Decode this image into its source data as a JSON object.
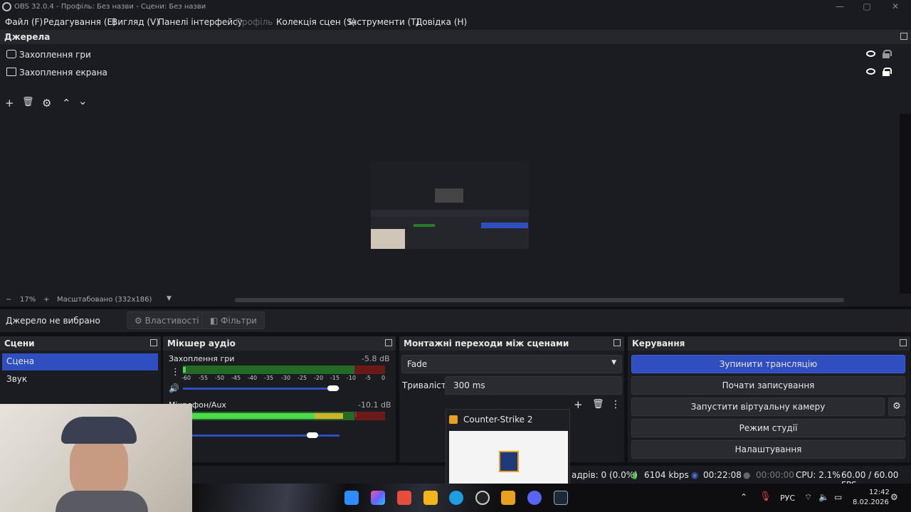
{
  "window": {
    "title": "OBS 32.0.4 - Профіль: Без назви - Сцени: Без назви"
  },
  "menu": [
    "Файл (F)",
    "Редагування (E)",
    "Вигляд (V)",
    "Панелі інтерфейсу",
    "Профіль",
    "Колекція сцен (S)",
    "Інструменти (T)",
    "Довідка (H)"
  ],
  "sources": {
    "title": "Джерела",
    "items": [
      {
        "label": "Захоплення гри",
        "icon": "gamepad-icon",
        "visible": true,
        "locked": false
      },
      {
        "label": "Захоплення екрана",
        "icon": "monitor-icon",
        "visible": true,
        "locked": true
      }
    ]
  },
  "zoom": {
    "minus": "−",
    "percent": "17%",
    "plus": "+",
    "scale": "Масштабовано (332x186)"
  },
  "source_bar": {
    "none": "Джерело не вибрано",
    "properties": "Властивості",
    "filters": "Фільтри"
  },
  "scenes": {
    "title": "Сцени",
    "items": [
      "Сцена",
      "Звук"
    ],
    "selected": 0
  },
  "mixer": {
    "title": "Мікшер аудіо",
    "channels": [
      {
        "name": "Захоплення гри",
        "db": "-5.8 dB",
        "level": 0.08,
        "volume": 0.8
      },
      {
        "name": "Мікрофон/Aux",
        "db": "-10.1 dB",
        "level": 0.64,
        "volume": 0.65
      }
    ],
    "ticks": [
      "-60",
      "-55",
      "-50",
      "-45",
      "-40",
      "-35",
      "-30",
      "-25",
      "-20",
      "-15",
      "-10",
      "-5",
      "0"
    ]
  },
  "transitions": {
    "title": "Монтажні переходи між сценами",
    "type": "Fade",
    "duration_label": "Тривалість",
    "duration": "300 ms"
  },
  "controls": {
    "title": "Керування",
    "buttons": [
      "Зупинити трансляцію",
      "Почати записування",
      "Запустити віртуальну камеру",
      "Режим студії",
      "Налаштування"
    ]
  },
  "popup": {
    "title": "Counter-Strike 2"
  },
  "status": {
    "frames": "адрів: 0 (0.0%)",
    "bitrate": "6104 kbps",
    "stream_time": "00:22:08",
    "rec_time": "00:00:00",
    "cpu": "CPU: 2.1%",
    "fps": "60.00 / 60.00 FPS"
  },
  "tray": {
    "lang": "РУС",
    "time": "12:42",
    "date": "8.02.2026"
  },
  "colors": {
    "accent": "#2f4ec0",
    "bg": "#1b1c21"
  }
}
